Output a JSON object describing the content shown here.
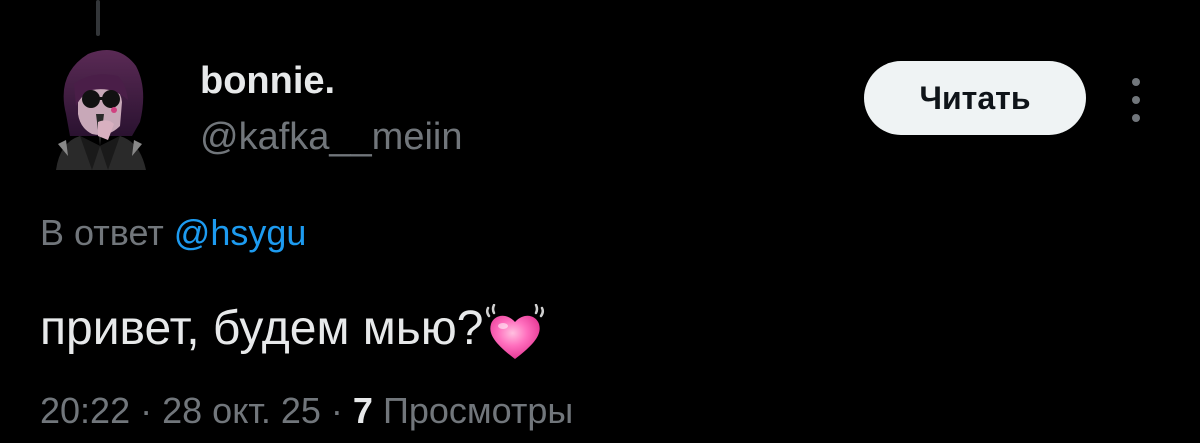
{
  "author": {
    "display_name": "bonnie.",
    "handle": "@kafka__meiin"
  },
  "follow_button": {
    "label": "Читать"
  },
  "reply": {
    "prefix": "В ответ",
    "mention": "@hsygu"
  },
  "tweet": {
    "text": "привет, будем мью?",
    "emoji_icon": "growing-heart-emoji"
  },
  "meta": {
    "time": "20:22",
    "separator": "·",
    "date": "28 окт. 25",
    "views_count": "7",
    "views_label": "Просмотры"
  },
  "colors": {
    "background": "#000000",
    "primary_text": "#e7e9ea",
    "secondary_text": "#71767b",
    "link": "#1d9bf0",
    "button_bg": "#eff3f4",
    "button_text": "#0f1419",
    "heart": "#ff5ab4"
  }
}
